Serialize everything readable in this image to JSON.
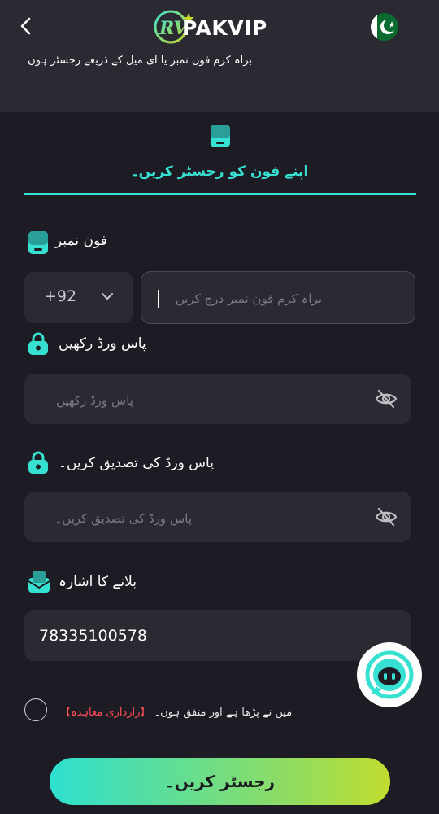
{
  "header": {
    "brand": "PAKVIP",
    "subtitle": "براہ کرم فون نمبر یا ای میل کے ذریعے رجسٹر ہوں۔",
    "flag": "pakistan-flag-icon"
  },
  "tab": {
    "title": "اپنے فون کو رجسٹر کریں۔"
  },
  "form": {
    "phone_label": "فون نمبر",
    "country_code": "+92",
    "phone_placeholder": "براہ کرم فون نمبر درج کریں",
    "password_label": "پاس ورڈ رکھیں",
    "password_placeholder": "پاس ورڈ رکھیں",
    "confirm_label": "پاس ورڈ کی تصدیق کریں۔",
    "confirm_placeholder": "پاس ورڈ کی تصدیق کریں۔",
    "invite_label": "بلانے کا اشارہ",
    "invite_value": "78335100578",
    "agree_text": "میں نے پڑھا ہے اور متفق ہوں۔",
    "privacy_link": "【رازداری معاہدہ】"
  },
  "submit_label": "رجسٹر کریں۔",
  "colors": {
    "accent": "#37e1d1",
    "background": "#1d1c24",
    "panel": "#2b2a33",
    "link": "#ff4d57"
  }
}
